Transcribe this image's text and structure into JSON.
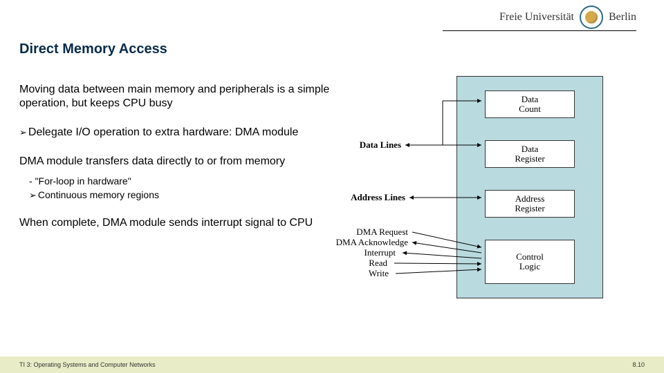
{
  "header": {
    "university_prefix": "Freie Universität",
    "university_suffix": "Berlin"
  },
  "title": "Direct Memory Access",
  "body": {
    "p1": "Moving data between main memory and peripherals is a simple operation, but keeps CPU busy",
    "p2": "Delegate I/O operation to extra hardware: DMA module",
    "p3": "DMA module transfers data directly to or from memory",
    "sub1": "- \"For-loop in hardware\"",
    "sub2": "Continuous memory regions",
    "p4": "When complete, DMA module sends interrupt signal to CPU"
  },
  "diagram": {
    "boxes": {
      "data_count": "Data\nCount",
      "data_register": "Data\nRegister",
      "address_register": "Address\nRegister",
      "control_logic": "Control\nLogic"
    },
    "labels": {
      "data_lines": "Data Lines",
      "address_lines": "Address Lines",
      "dma_request": "DMA Request",
      "dma_ack": "DMA Acknowledge",
      "interrupt": "Interrupt",
      "read": "Read",
      "write": "Write"
    }
  },
  "footer": {
    "left": "TI 3: Operating Systems and Computer Networks",
    "right": "8.10"
  }
}
